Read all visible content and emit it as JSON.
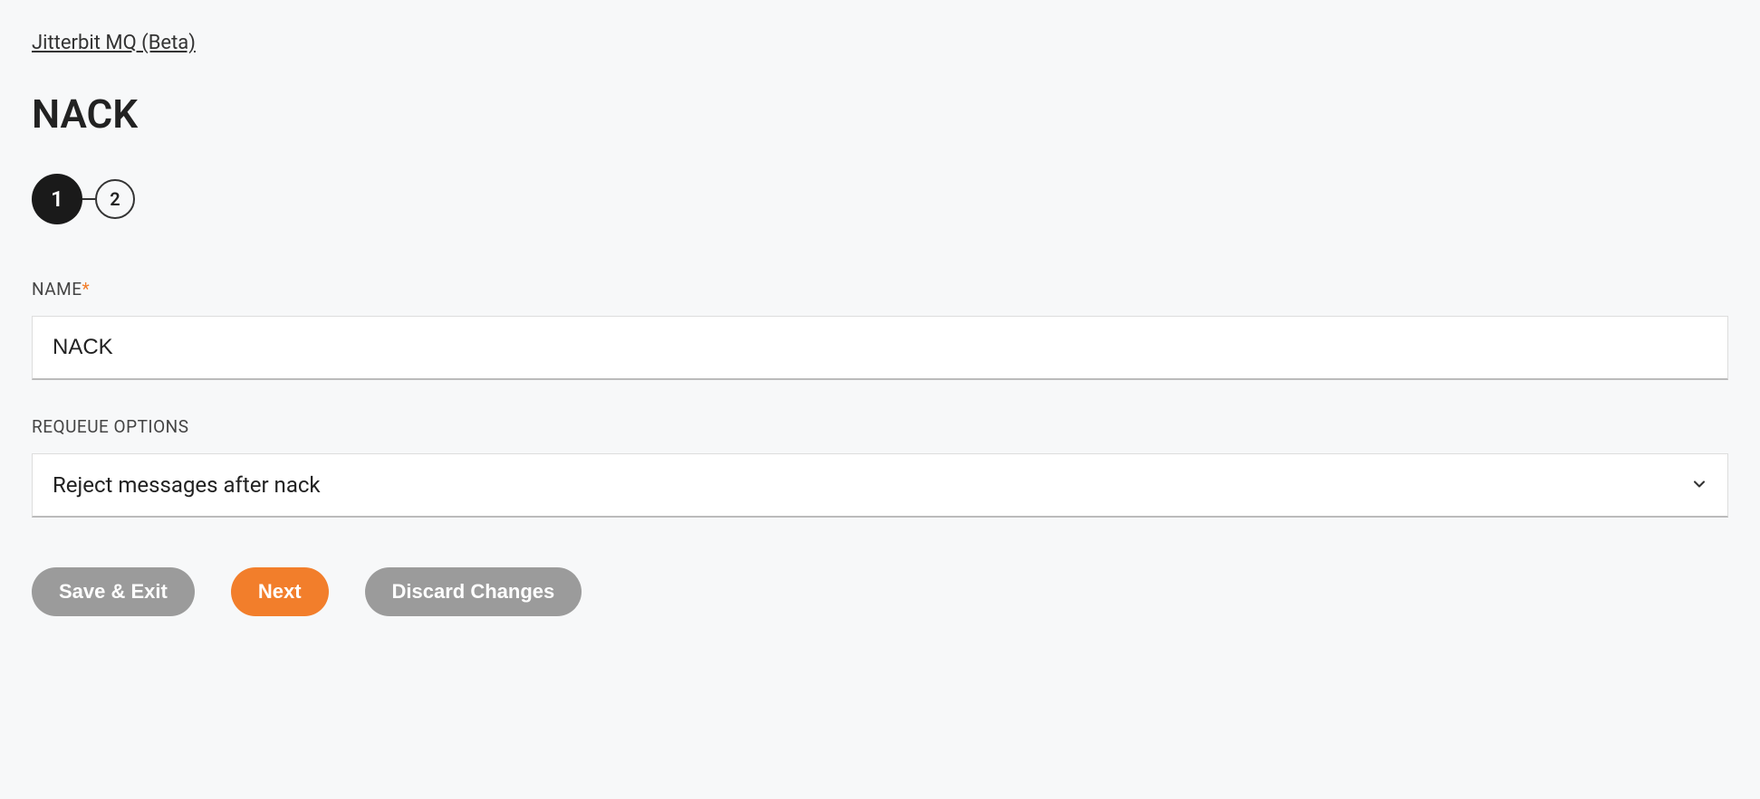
{
  "breadcrumb": {
    "label": "Jitterbit MQ (Beta)"
  },
  "page": {
    "title": "NACK"
  },
  "stepper": {
    "steps": [
      {
        "label": "1",
        "active": true
      },
      {
        "label": "2",
        "active": false
      }
    ]
  },
  "form": {
    "name": {
      "label": "NAME",
      "required_marker": "*",
      "value": "NACK"
    },
    "requeue": {
      "label": "REQUEUE OPTIONS",
      "selected": "Reject messages after nack"
    }
  },
  "buttons": {
    "save_exit": "Save & Exit",
    "next": "Next",
    "discard": "Discard Changes"
  }
}
